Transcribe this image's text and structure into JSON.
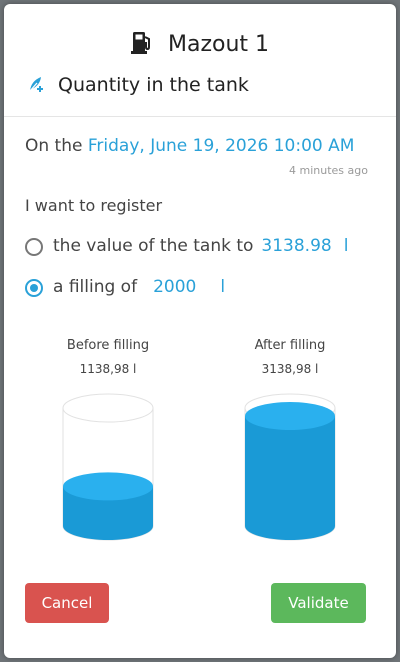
{
  "dialog": {
    "title": "Mazout 1",
    "subtitle": "Quantity in the tank",
    "on_prefix": "On the",
    "date": "Friday, June 19, 2026 10:00 AM",
    "relative_time": "4 minutes ago",
    "register_label": "I want to register",
    "option_value": {
      "label": "the value of the tank to",
      "value": "3138.98",
      "unit": "l",
      "selected": false
    },
    "option_filling": {
      "label": "a filling of",
      "value": "2000",
      "unit": "l",
      "selected": true
    },
    "tanks": {
      "before": {
        "label": "Before filling",
        "value": "1138,98 l",
        "fill_fraction": 0.36
      },
      "after": {
        "label": "After filling",
        "value": "3138,98 l",
        "fill_fraction": 1.0
      }
    },
    "cancel_label": "Cancel",
    "validate_label": "Validate"
  },
  "colors": {
    "accent": "#2aa1d8",
    "tank_fill": "#1a9ad6",
    "tank_top": "#2ab0ee",
    "cancel": "#d9534f",
    "validate": "#5cb85c"
  },
  "icons": {
    "title_icon": "fuel-pump-icon",
    "subtitle_icon": "leaf-plus-icon"
  }
}
